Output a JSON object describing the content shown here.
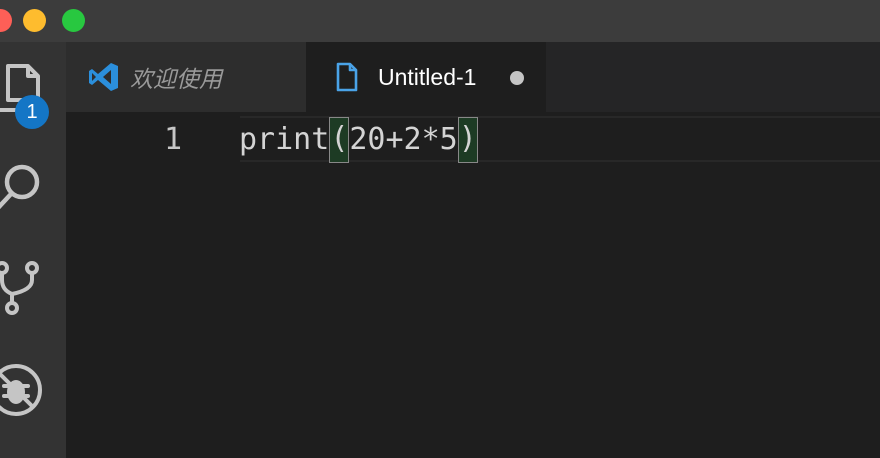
{
  "window": {
    "traffic_lights": {
      "close_color": "#fe5f57",
      "minimize_color": "#febc2e",
      "maximize_color": "#28c840"
    }
  },
  "activity_bar": {
    "background": "#333333",
    "items": [
      {
        "icon": "files-icon",
        "badge": "1"
      },
      {
        "icon": "search-icon"
      },
      {
        "icon": "source-control-icon"
      },
      {
        "icon": "debug-icon"
      }
    ]
  },
  "tabs": [
    {
      "label": "欢迎使用",
      "icon": "vscode-logo-icon",
      "active": false
    },
    {
      "label": "Untitled-1",
      "icon": "file-icon",
      "active": true,
      "dirty": true
    }
  ],
  "editor": {
    "line_number": "1",
    "code": {
      "function_name": "print",
      "open_paren": "(",
      "expression": "20+2*5",
      "close_paren": ")"
    }
  },
  "colors": {
    "accent": "#1476c6",
    "editor_background": "#1e1e1e",
    "tab_bar_background": "#252526",
    "title_bar_background": "#3c3c3c"
  }
}
